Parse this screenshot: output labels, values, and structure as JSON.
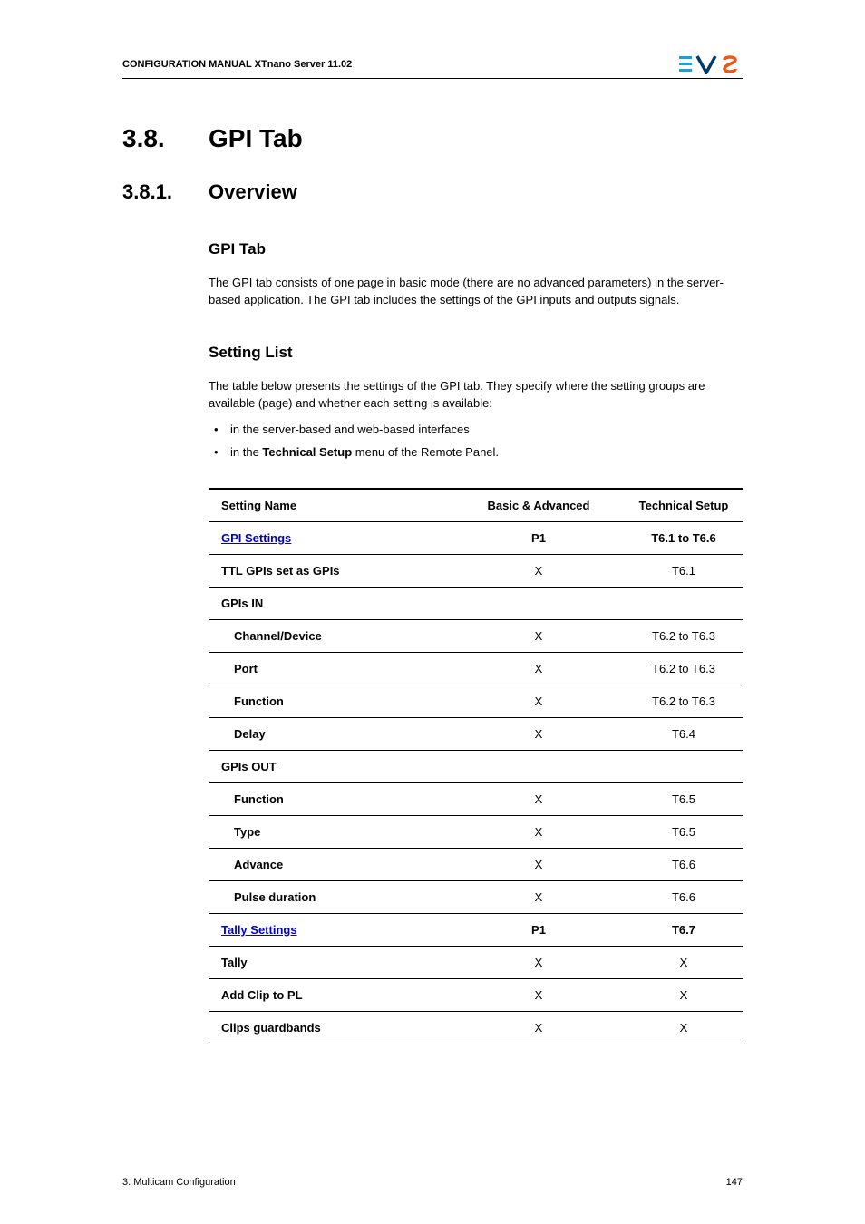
{
  "header": {
    "title": "CONFIGURATION MANUAL  XTnano Server 11.02"
  },
  "section": {
    "num": "3.8.",
    "title": "GPI Tab"
  },
  "subsection": {
    "num": "3.8.1.",
    "title": "Overview"
  },
  "gpitab": {
    "heading": "GPI Tab",
    "para": "The GPI tab consists of one page in basic mode (there are no advanced parameters) in the server-based application. The GPI tab includes the settings of the GPI inputs and outputs signals."
  },
  "settinglist": {
    "heading": "Setting List",
    "intro": "The table below presents the settings of the GPI tab. They specify where the setting groups are available (page) and whether each setting is available:",
    "bullet1_a": "in the server-based and web-based interfaces",
    "bullet2_a": "in the ",
    "bullet2_b": "Technical Setup",
    "bullet2_c": " menu of the Remote Panel."
  },
  "table": {
    "headers": {
      "name": "Setting Name",
      "basic": "Basic & Advanced",
      "tech": "Technical Setup"
    },
    "rows": [
      {
        "name": "GPI Settings",
        "basic": "P1",
        "tech": "T6.1 to T6.6",
        "link": true,
        "bold": true
      },
      {
        "name": "TTL GPIs set as GPIs",
        "basic": "X",
        "tech": "T6.1",
        "bold": true
      },
      {
        "name": "GPIs IN",
        "basic": "",
        "tech": "",
        "bold": true
      },
      {
        "name": "Channel/Device",
        "basic": "X",
        "tech": "T6.2 to T6.3",
        "indent": true,
        "bold": true
      },
      {
        "name": "Port",
        "basic": "X",
        "tech": "T6.2 to T6.3",
        "indent": true,
        "bold": true
      },
      {
        "name": "Function",
        "basic": "X",
        "tech": "T6.2 to T6.3",
        "indent": true,
        "bold": true
      },
      {
        "name": "Delay",
        "basic": "X",
        "tech": "T6.4",
        "indent": true,
        "bold": true
      },
      {
        "name": "GPIs OUT",
        "basic": "",
        "tech": "",
        "bold": true
      },
      {
        "name": "Function",
        "basic": "X",
        "tech": "T6.5",
        "indent": true,
        "bold": true
      },
      {
        "name": "Type",
        "basic": "X",
        "tech": "T6.5",
        "indent": true,
        "bold": true
      },
      {
        "name": "Advance",
        "basic": "X",
        "tech": "T6.6",
        "indent": true,
        "bold": true
      },
      {
        "name": "Pulse duration",
        "basic": "X",
        "tech": "T6.6",
        "indent": true,
        "bold": true
      },
      {
        "name": "Tally Settings",
        "basic": "P1",
        "tech": "T6.7",
        "link": true,
        "bold": true
      },
      {
        "name": "Tally",
        "basic": "X",
        "tech": "X",
        "bold": true
      },
      {
        "name": "Add Clip to PL",
        "basic": "X",
        "tech": "X",
        "bold": true
      },
      {
        "name": "Clips guardbands",
        "basic": "X",
        "tech": "X",
        "bold": true
      }
    ]
  },
  "footer": {
    "left": "3. Multicam Configuration",
    "right": "147"
  }
}
